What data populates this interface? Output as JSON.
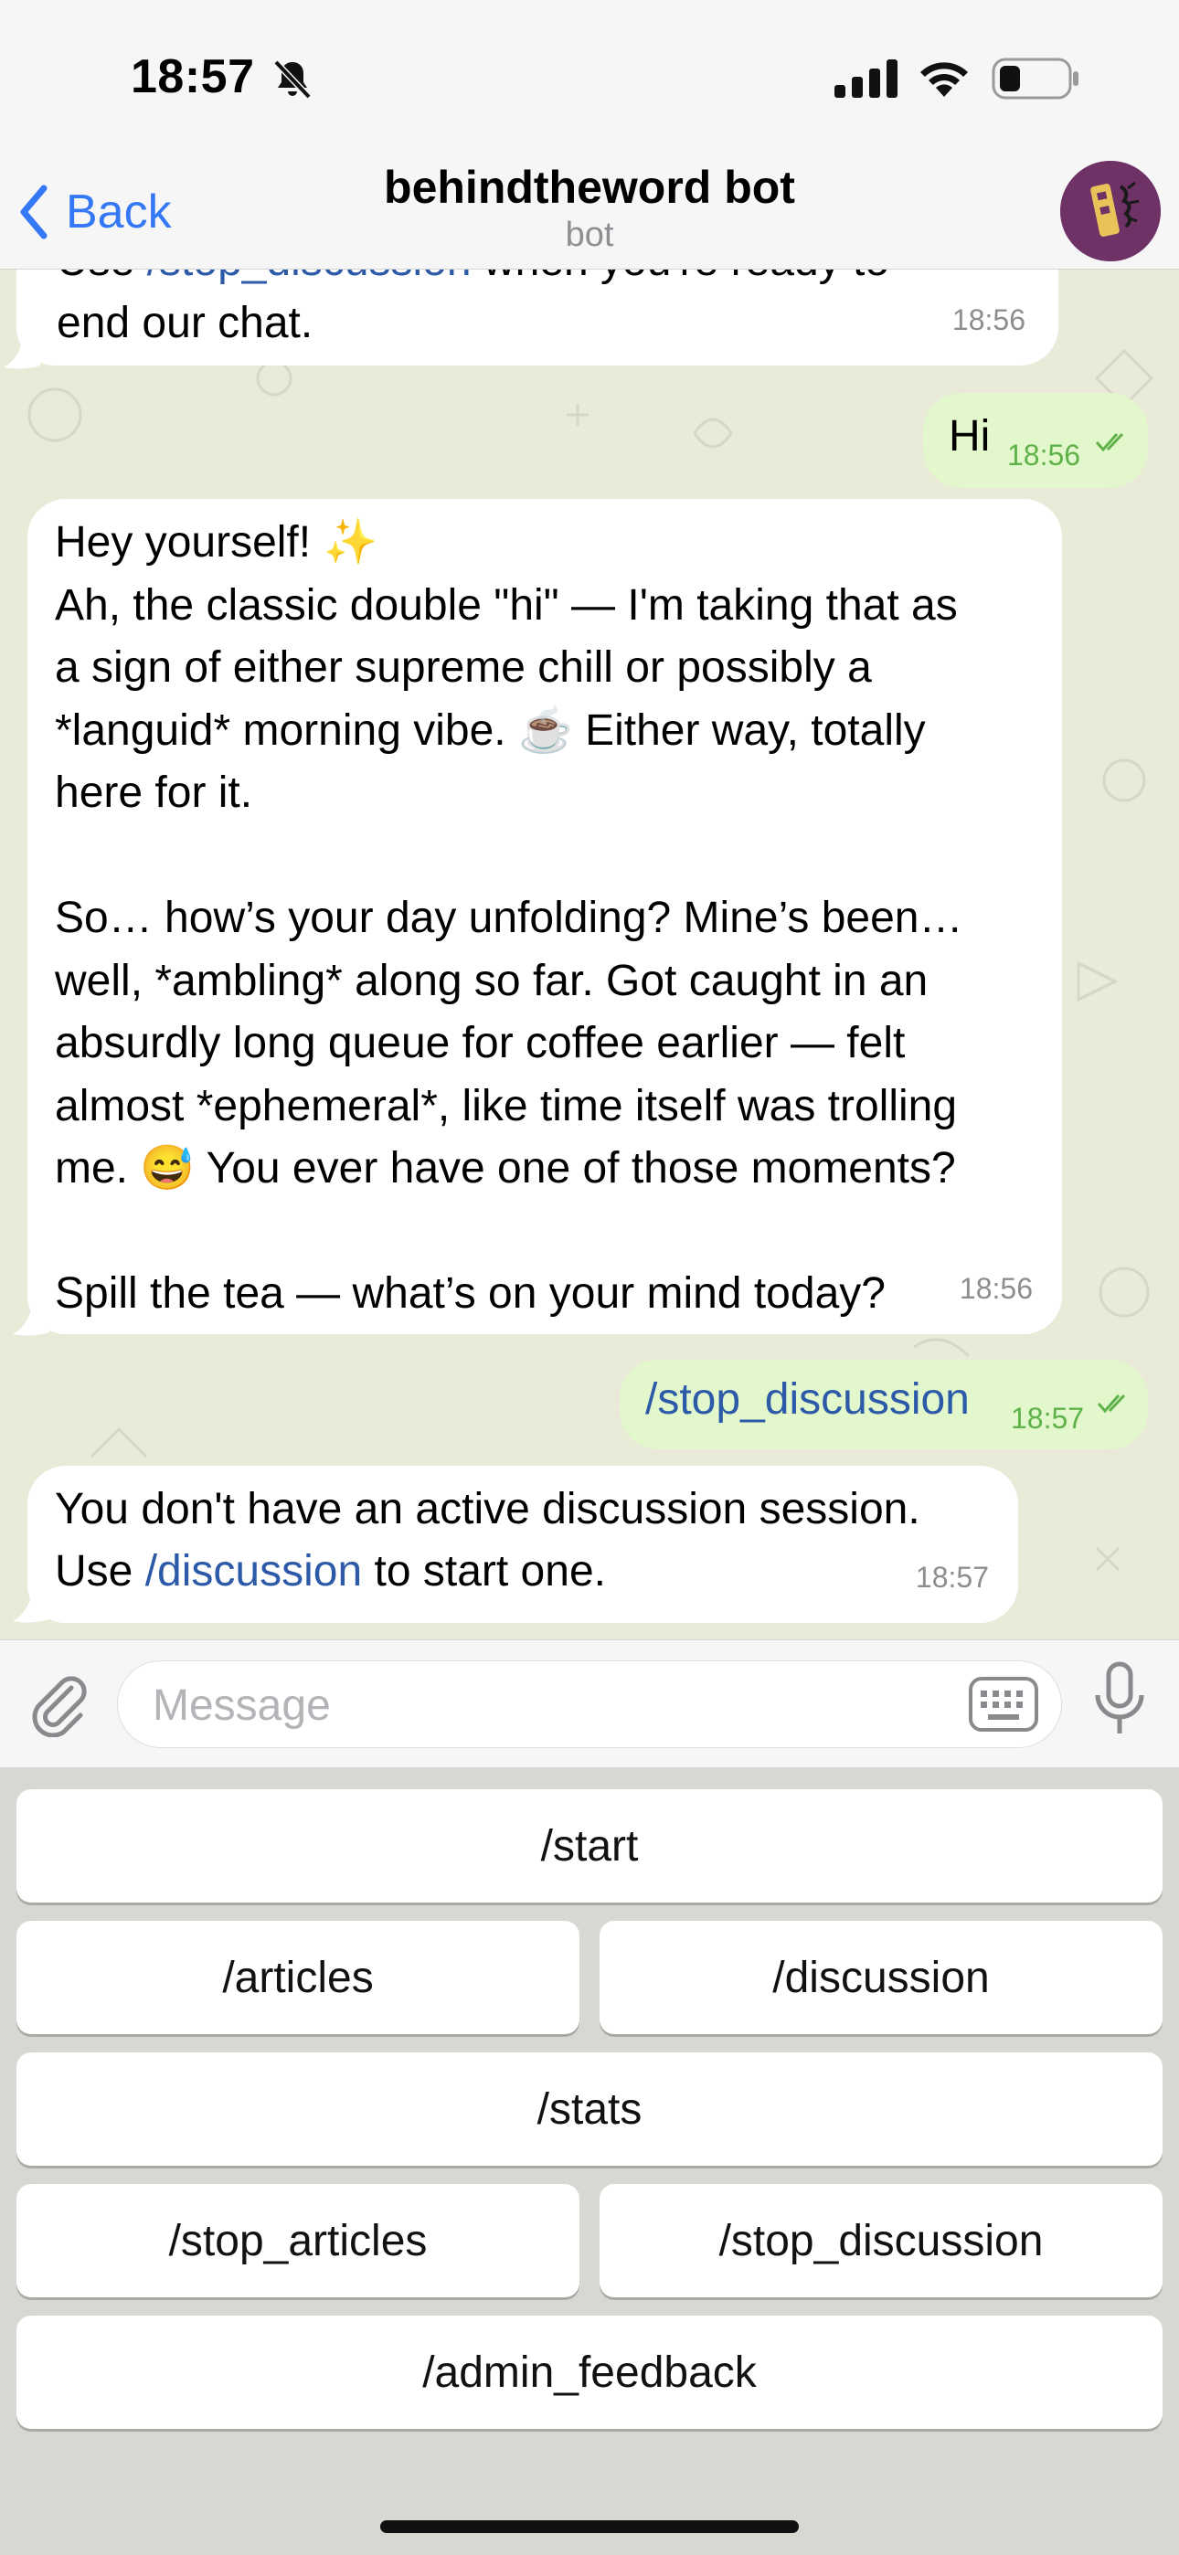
{
  "status_bar": {
    "time": "18:57"
  },
  "nav": {
    "back_label": "Back",
    "title": "behindtheword bot",
    "subtitle": "bot"
  },
  "messages": [
    {
      "id": "m0",
      "direction": "incoming",
      "line1_prefix": "Use ",
      "line1_link": "/stop_discussion",
      "line1_suffix": " when you're ready to",
      "line2": "end our chat.",
      "time": "18:56"
    },
    {
      "id": "m1",
      "direction": "outgoing",
      "text": "Hi",
      "time": "18:56"
    },
    {
      "id": "m2",
      "direction": "incoming",
      "text": "Hey yourself! ✨\nAh, the classic double \"hi\" — I'm taking that as\na sign of either supreme chill or possibly a\n*languid* morning vibe. ☕ Either way, totally\nhere for it.\n\nSo… how’s your day unfolding? Mine’s been…\nwell, *ambling* along so far. Got caught in an\nabsurdly long queue for coffee earlier — felt\nalmost *ephemeral*, like time itself was trolling\nme. 😅 You ever have one of those moments?\n\nSpill the tea — what’s on your mind today?",
      "time": "18:56"
    },
    {
      "id": "m3",
      "direction": "outgoing",
      "link": "/stop_discussion",
      "time": "18:57"
    },
    {
      "id": "m4",
      "direction": "incoming",
      "line1": "You don't have an active discussion session.",
      "line2_prefix": "Use ",
      "line2_link": "/discussion",
      "line2_suffix": " to start one.",
      "time": "18:57"
    }
  ],
  "input": {
    "placeholder": "Message",
    "value": ""
  },
  "keyboard": {
    "buttons": [
      "/start",
      "/articles",
      "/discussion",
      "/stats",
      "/stop_articles",
      "/stop_discussion",
      "/admin_feedback"
    ]
  },
  "colors": {
    "accent": "#3478f6",
    "incoming_bubble": "#ffffff",
    "outgoing_bubble": "#e2f7cb",
    "link": "#2c5aa8",
    "outgoing_time": "#5fb249"
  },
  "icons": [
    "bell-slash-icon",
    "signal-icon",
    "wifi-icon",
    "battery-icon",
    "chevron-left-icon",
    "paperclip-icon",
    "keyboard-icon",
    "microphone-icon",
    "double-check-icon"
  ]
}
